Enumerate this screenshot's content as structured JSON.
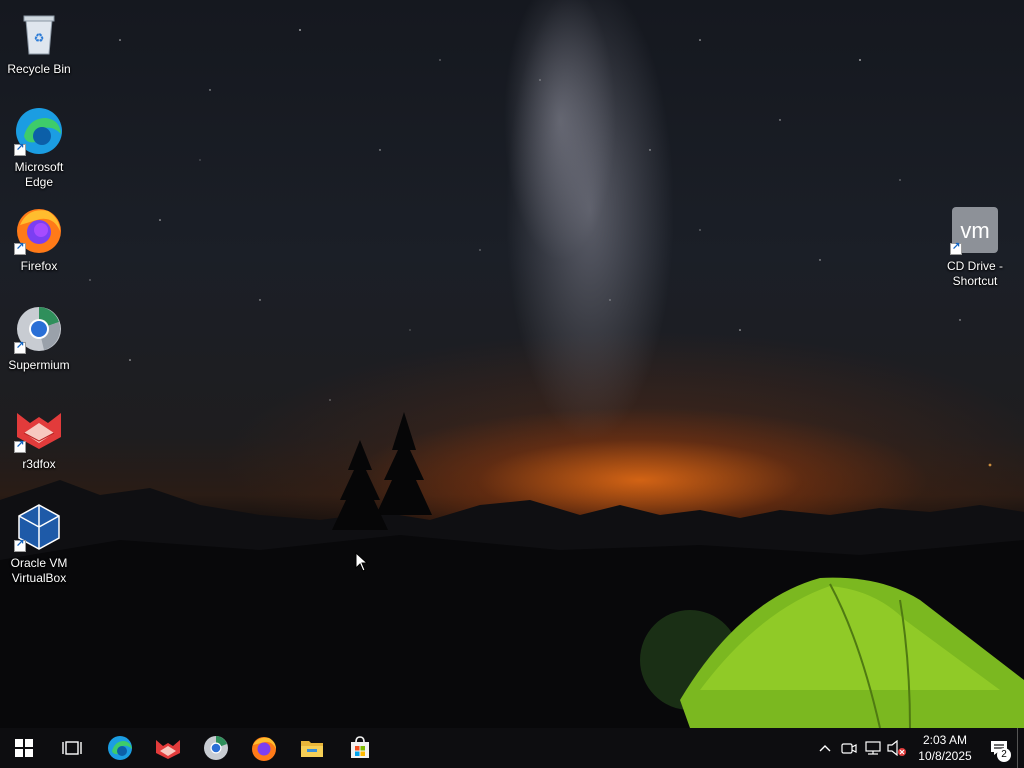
{
  "desktop": {
    "icons": [
      {
        "label": "Recycle Bin",
        "icon": "recycle-bin-icon"
      },
      {
        "label": "Microsoft Edge",
        "icon": "edge-icon"
      },
      {
        "label": "Firefox",
        "icon": "firefox-icon"
      },
      {
        "label": "Supermium",
        "icon": "supermium-icon"
      },
      {
        "label": "r3dfox",
        "icon": "r3dfox-icon"
      },
      {
        "label": "Oracle VM VirtualBox",
        "icon": "virtualbox-icon"
      },
      {
        "label": "CD Drive - Shortcut",
        "icon": "vmware-cd-icon"
      }
    ]
  },
  "taskbar": {
    "pinned": [
      "start-icon",
      "task-view-icon",
      "edge-icon",
      "r3dfox-icon",
      "supermium-icon",
      "firefox-icon",
      "file-explorer-icon",
      "store-icon"
    ],
    "tray": {
      "time": "2:03 AM",
      "date": "10/8/2025",
      "notification_count": "2"
    }
  }
}
